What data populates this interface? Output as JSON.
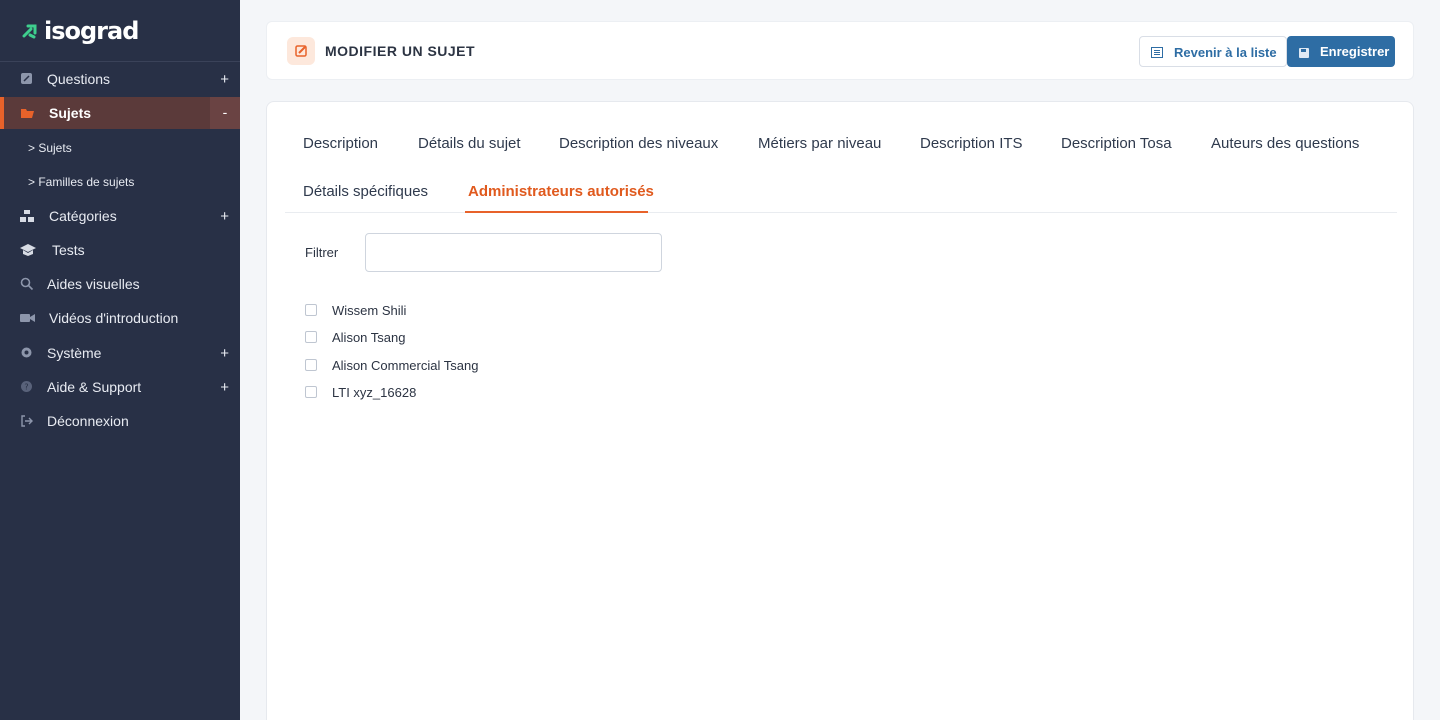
{
  "app": {
    "logo_text": "isograd",
    "accent_color": "#e8622a",
    "primary_color": "#2e6da4",
    "sidebar_color": "#283046"
  },
  "sidebar": {
    "items": [
      {
        "label": "Questions",
        "icon": "edit-square-icon",
        "toggle": "+"
      },
      {
        "label": "Sujets",
        "icon": "folder-open-icon",
        "toggle": "-",
        "active": true
      },
      {
        "label": "Catégories",
        "icon": "sitemap-icon",
        "toggle": "+"
      },
      {
        "label": "Tests",
        "icon": "graduation-cap-icon",
        "toggle": ""
      },
      {
        "label": "Aides visuelles",
        "icon": "search-icon",
        "toggle": ""
      },
      {
        "label": "Vidéos d'introduction",
        "icon": "video-camera-icon",
        "toggle": ""
      },
      {
        "label": "Système",
        "icon": "gear-icon",
        "toggle": "+"
      },
      {
        "label": "Aide & Support",
        "icon": "question-circle-icon",
        "toggle": "+"
      },
      {
        "label": "Déconnexion",
        "icon": "logout-icon",
        "toggle": ""
      }
    ],
    "subitems": [
      "> Sujets",
      "> Familles de sujets"
    ]
  },
  "header": {
    "title": "MODIFIER UN SUJET",
    "back_label": "Revenir à la liste",
    "save_label": "Enregistrer"
  },
  "tabs": [
    {
      "label": "Description"
    },
    {
      "label": "Détails du sujet"
    },
    {
      "label": "Description des niveaux"
    },
    {
      "label": "Métiers par niveau"
    },
    {
      "label": "Description ITS"
    },
    {
      "label": "Description Tosa"
    },
    {
      "label": "Auteurs des questions"
    },
    {
      "label": "Détails spécifiques"
    },
    {
      "label": "Administrateurs autorisés",
      "active": true
    }
  ],
  "filter": {
    "label": "Filtrer",
    "value": "",
    "placeholder": ""
  },
  "admins": [
    {
      "name": "Wissem Shili",
      "checked": false
    },
    {
      "name": "Alison Tsang",
      "checked": false
    },
    {
      "name": "Alison Commercial Tsang",
      "checked": false
    },
    {
      "name": "LTI xyz_16628",
      "checked": false
    }
  ]
}
